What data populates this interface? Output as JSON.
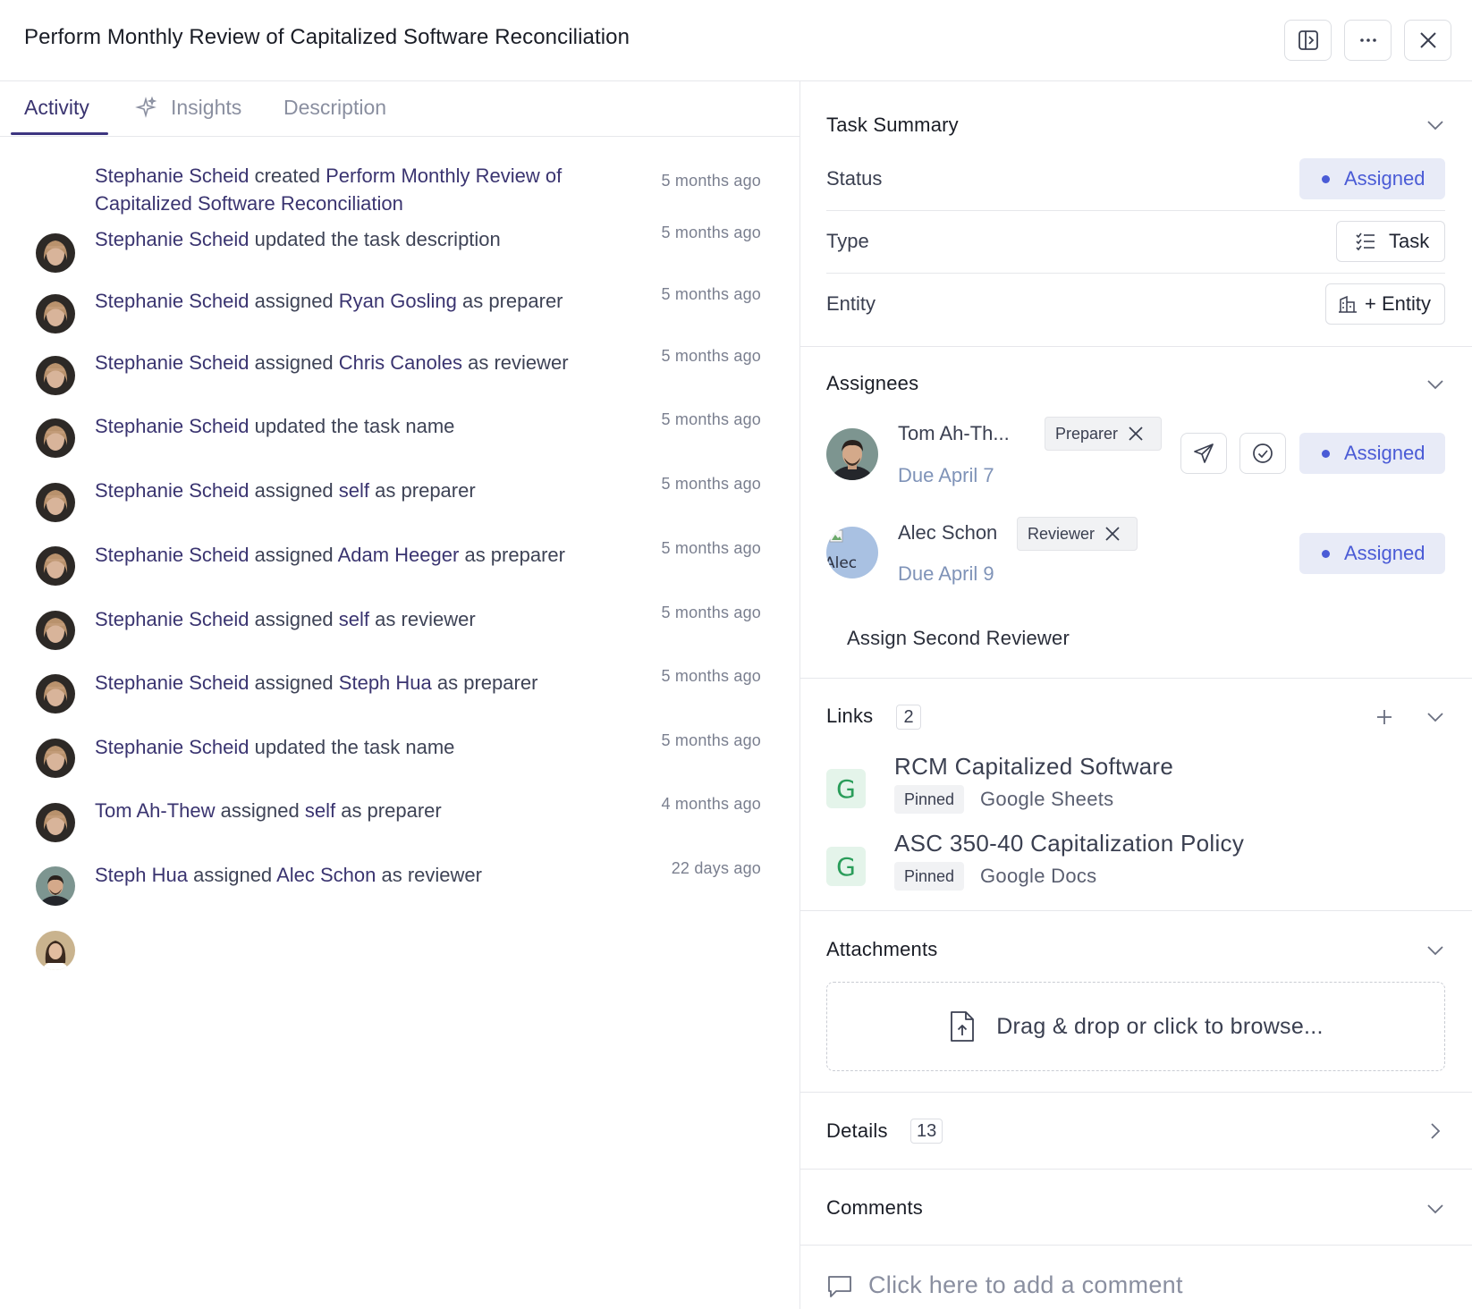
{
  "header": {
    "title": "Perform Monthly Review of Capitalized Software Reconciliation",
    "buttons": [
      "sidebar-toggle-icon",
      "more-icon",
      "close-icon"
    ]
  },
  "tabs": [
    {
      "label": "Activity",
      "active": true
    },
    {
      "label": "Insights",
      "icon": "sparkle-icon"
    },
    {
      "label": "Description"
    }
  ],
  "activity": [
    {
      "actor": "Stephanie Scheid",
      "verb": "created",
      "target": "Perform Monthly Review of Capitalized Software Reconciliation",
      "suffix": "",
      "time": "5 months ago"
    },
    {
      "actor": "Stephanie Scheid",
      "verb": "updated the task description",
      "target": "",
      "suffix": "",
      "time": "5 months ago"
    },
    {
      "actor": "Stephanie Scheid",
      "verb": "assigned",
      "target": "Ryan Gosling",
      "suffix": "as preparer",
      "time": "5 months ago"
    },
    {
      "actor": "Stephanie Scheid",
      "verb": "assigned",
      "target": "Chris Canoles",
      "suffix": "as reviewer",
      "time": "5 months ago"
    },
    {
      "actor": "Stephanie Scheid",
      "verb": "updated the task name",
      "target": "",
      "suffix": "",
      "time": "5 months ago"
    },
    {
      "actor": "Stephanie Scheid",
      "verb": "assigned",
      "target": "self",
      "suffix": "as preparer",
      "time": "5 months ago"
    },
    {
      "actor": "Stephanie Scheid",
      "verb": "assigned",
      "target": "Adam Heeger",
      "suffix": "as preparer",
      "time": "5 months ago"
    },
    {
      "actor": "Stephanie Scheid",
      "verb": "assigned",
      "target": "self",
      "suffix": "as reviewer",
      "time": "5 months ago"
    },
    {
      "actor": "Stephanie Scheid",
      "verb": "assigned",
      "target": "Steph Hua",
      "suffix": "as preparer",
      "time": "5 months ago"
    },
    {
      "actor": "Stephanie Scheid",
      "verb": "updated the task name",
      "target": "",
      "suffix": "",
      "time": "5 months ago"
    },
    {
      "actor": "Tom Ah-Thew",
      "verb": "assigned",
      "target": "self",
      "suffix": "as preparer",
      "time": "4 months ago"
    },
    {
      "actor": "Steph Hua",
      "verb": "assigned",
      "target": "Alec Schon",
      "suffix": "as reviewer",
      "time": "22 days ago"
    }
  ],
  "task_summary": {
    "title": "Task Summary",
    "status_label": "Status",
    "status_value": "Assigned",
    "type_label": "Type",
    "type_value": "Task",
    "entity_label": "Entity",
    "entity_value": "+ Entity"
  },
  "assignees": {
    "title": "Assignees",
    "items": [
      {
        "name": "Tom Ah-Th...",
        "role": "Preparer",
        "due": "Due April 7",
        "status": "Assigned"
      },
      {
        "name": "Alec Schon",
        "role": "Reviewer",
        "due": "Due April 9",
        "status": "Assigned",
        "avatar_alt": "Alec"
      }
    ],
    "assign_second": "Assign Second Reviewer"
  },
  "links": {
    "title": "Links",
    "count": "2",
    "items": [
      {
        "title": "RCM Capitalized Software",
        "badge": "Pinned",
        "app": "Google Sheets",
        "icon_letter": "G"
      },
      {
        "title": "ASC 350-40 Capitalization Policy",
        "badge": "Pinned",
        "app": "Google Docs",
        "icon_letter": "G"
      }
    ]
  },
  "attachments": {
    "title": "Attachments",
    "dropzone": "Drag & drop or click to browse..."
  },
  "details": {
    "title": "Details",
    "count": "13"
  },
  "comments": {
    "title": "Comments",
    "placeholder": "Click here to add a comment"
  },
  "colors": {
    "accent": "#3a3470",
    "status_bg": "#e8ebf7",
    "status_text": "#4a5bd6",
    "link_icon": "#2a9d5a"
  }
}
